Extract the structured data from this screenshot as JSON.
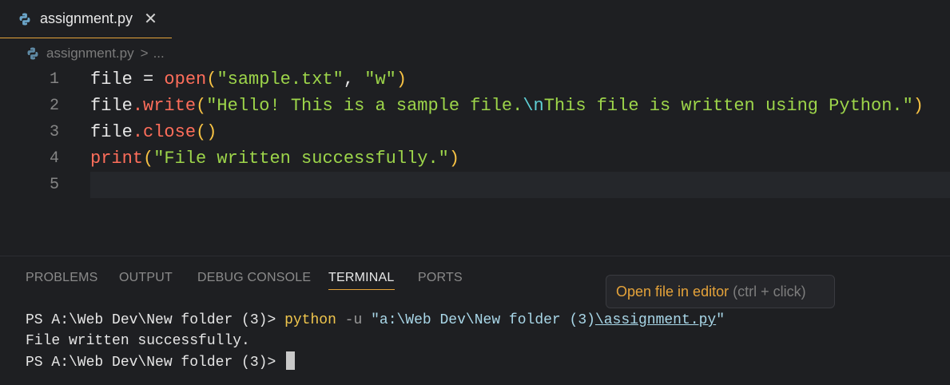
{
  "tab": {
    "title": "assignment.py",
    "close_glyph": "✕"
  },
  "breadcrumb": {
    "file": "assignment.py",
    "separator": ">",
    "more": "..."
  },
  "editor": {
    "line_numbers": [
      "1",
      "2",
      "3",
      "4",
      "5"
    ],
    "lines": [
      [
        {
          "t": "file = ",
          "c": "plain"
        },
        {
          "t": "open",
          "c": "fn"
        },
        {
          "t": "(",
          "c": "paren"
        },
        {
          "t": "\"sample.txt\"",
          "c": "str"
        },
        {
          "t": ", ",
          "c": "punct"
        },
        {
          "t": "\"w\"",
          "c": "str"
        },
        {
          "t": ")",
          "c": "paren"
        }
      ],
      [
        {
          "t": "file",
          "c": "plain"
        },
        {
          "t": ".",
          "c": "dot"
        },
        {
          "t": "write",
          "c": "fn"
        },
        {
          "t": "(",
          "c": "paren"
        },
        {
          "t": "\"Hello! This is a sample file.",
          "c": "str"
        },
        {
          "t": "\\n",
          "c": "esc"
        },
        {
          "t": "This file is written using Python.\"",
          "c": "str"
        },
        {
          "t": ")",
          "c": "paren"
        }
      ],
      [
        {
          "t": "file",
          "c": "plain"
        },
        {
          "t": ".",
          "c": "dot"
        },
        {
          "t": "close",
          "c": "fn"
        },
        {
          "t": "()",
          "c": "paren"
        }
      ],
      [
        {
          "t": "print",
          "c": "fn"
        },
        {
          "t": "(",
          "c": "paren"
        },
        {
          "t": "\"File written successfully.\"",
          "c": "str"
        },
        {
          "t": ")",
          "c": "paren"
        }
      ],
      []
    ],
    "current_line": 5
  },
  "panel": {
    "tabs": [
      "PROBLEMS",
      "OUTPUT",
      "DEBUG CONSOLE",
      "TERMINAL",
      "PORTS"
    ],
    "active_tab": "TERMINAL"
  },
  "tooltip": {
    "main": "Open file in editor",
    "hint": "(ctrl + click)"
  },
  "terminal": {
    "line1": {
      "prompt": "PS A:\\Web Dev\\New folder (3)> ",
      "cmd": "python",
      "flag": " -u ",
      "str_start": "\"a:\\Web Dev\\New folder (3)",
      "link": "\\assignment.py",
      "str_end": "\""
    },
    "line2": "File written successfully.",
    "line3_prompt": "PS A:\\Web Dev\\New folder (3)> "
  },
  "colors": {
    "accent": "#e5a33a",
    "background": "#1e1f22",
    "string": "#9dd54a",
    "function": "#ff6e5b"
  }
}
